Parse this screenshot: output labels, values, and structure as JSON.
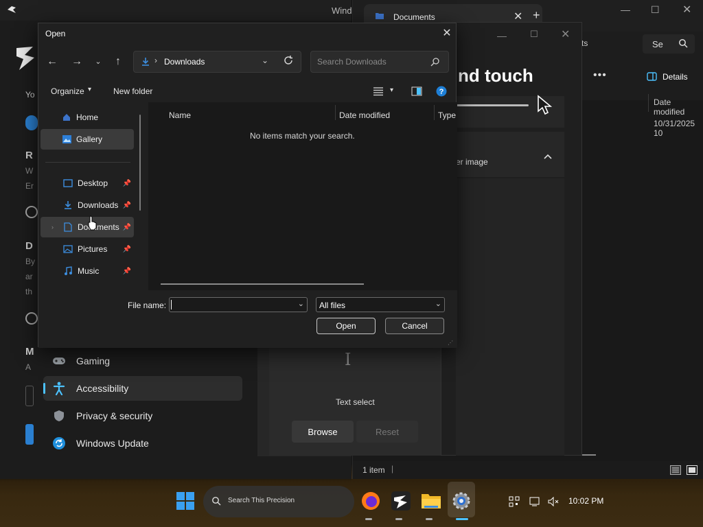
{
  "settings": {
    "window_title": "Wind",
    "nav": [
      {
        "label": "Gaming",
        "icon": "gamepad-icon"
      },
      {
        "label": "Accessibility",
        "icon": "accessibility-icon",
        "active": true
      },
      {
        "label": "Privacy & security",
        "icon": "shield-icon"
      },
      {
        "label": "Windows Update",
        "icon": "refresh-icon"
      }
    ],
    "fragments": [
      "Yo",
      "R",
      "W",
      "Er",
      "D",
      "By",
      "ar",
      "th",
      "M",
      "A"
    ]
  },
  "explorer": {
    "tab_title": "Documents",
    "search_fragment": "Se",
    "fragment_ts": "ts",
    "details_label": "Details",
    "col_date_modified": "Date modified",
    "row_date": "10/31/2025 10",
    "status": "1 item"
  },
  "touch_panel": {
    "heading_fragment": "nd touch",
    "sub_fragment": "er image",
    "caption": "Text select",
    "browse": "Browse",
    "reset": "Reset"
  },
  "dialog": {
    "title": "Open",
    "address_crumb": "Downloads",
    "search_placeholder": "Search Downloads",
    "organize": "Organize",
    "new_folder": "New folder",
    "nav_items": [
      {
        "label": "Home",
        "icon": "home-icon"
      },
      {
        "label": "Gallery",
        "icon": "gallery-icon"
      },
      {
        "label": "Desktop",
        "icon": "desktop-icon",
        "pinned": true
      },
      {
        "label": "Downloads",
        "icon": "download-icon",
        "pinned": true
      },
      {
        "label": "Documents",
        "icon": "documents-icon",
        "pinned": true
      },
      {
        "label": "Pictures",
        "icon": "pictures-icon",
        "pinned": true
      },
      {
        "label": "Music",
        "icon": "music-icon",
        "pinned": true
      }
    ],
    "columns": [
      "Name",
      "Date modified",
      "Type"
    ],
    "empty_message": "No items match your search.",
    "file_name_label": "File name:",
    "file_name_value": "",
    "file_type": "All files",
    "open_button": "Open",
    "cancel_button": "Cancel"
  },
  "taskbar": {
    "search_text": "Search This Precision",
    "clock": "10:02 PM"
  },
  "colors": {
    "accent": "#4cc2ff",
    "dialog_bg": "#202020",
    "file_pane_bg": "#191919"
  }
}
